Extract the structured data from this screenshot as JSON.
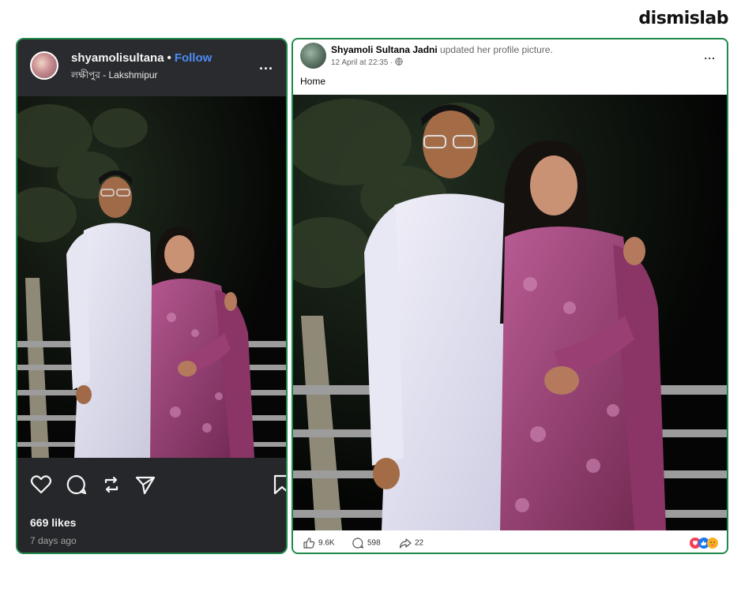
{
  "brand": {
    "logo_text": "dismislab"
  },
  "instagram": {
    "username": "shyamolisultana",
    "separator": "•",
    "follow_label": "Follow",
    "location": "লক্ষীপুর - Lakshmipur",
    "more_label": "...",
    "likes": "669 likes",
    "time_ago": "7 days ago",
    "icons": [
      "heart-icon",
      "comment-icon",
      "repost-icon",
      "share-icon",
      "bookmark-icon"
    ]
  },
  "facebook": {
    "name": "Shyamoli Sultana Jadni",
    "action": "updated her profile picture.",
    "date": "12 April at 22:35 ·",
    "privacy_icon": "globe-icon",
    "more_label": "...",
    "caption": "Home",
    "likes_count": "9.6K",
    "comments_count": "598",
    "shares_count": "22",
    "reaction_icons": [
      "love-reaction-icon",
      "like-reaction-icon",
      "care-reaction-icon"
    ]
  },
  "colors": {
    "card_border": "#1f8a4a",
    "follow_blue": "#4c8bf5",
    "ig_bg": "#26272b"
  }
}
